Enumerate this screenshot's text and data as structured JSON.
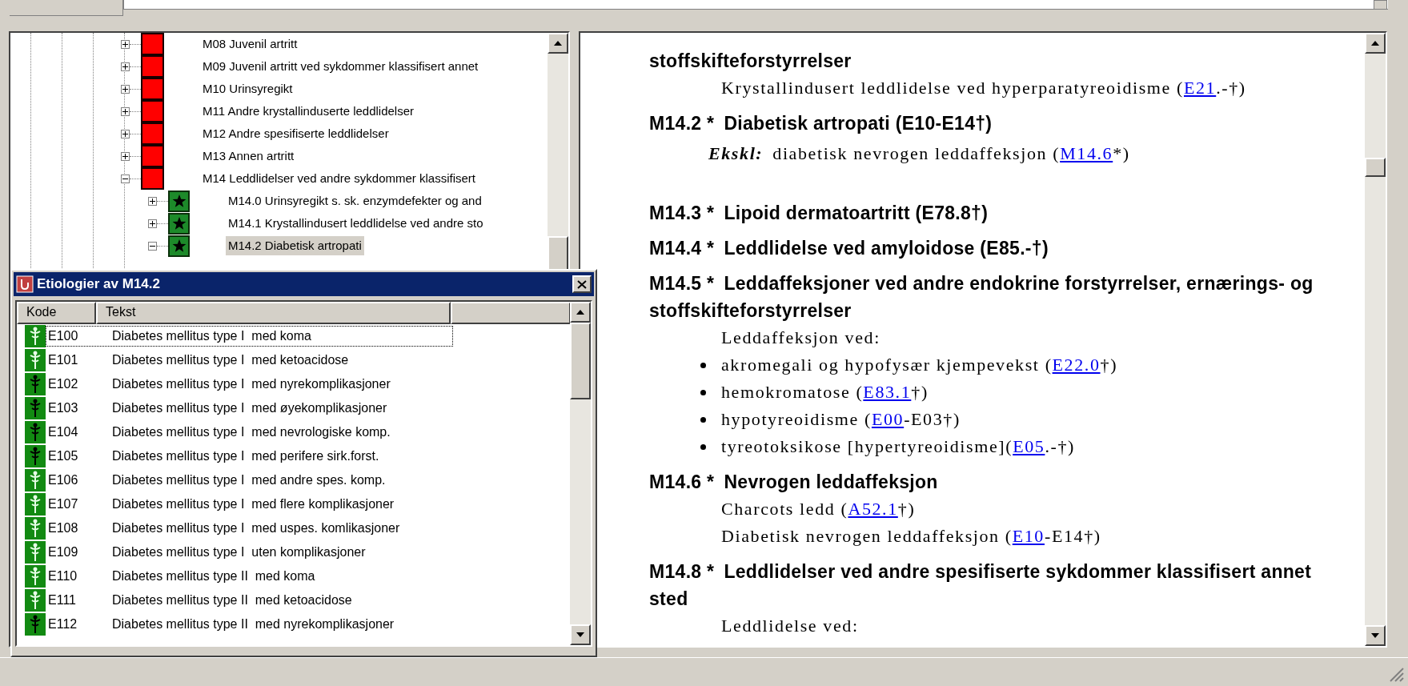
{
  "tree": {
    "items": [
      {
        "label": "M08 Juvenil artritt",
        "kind": "block",
        "expanded": false,
        "selected": false
      },
      {
        "label": "M09 Juvenil artritt ved sykdommer klassifisert annet",
        "kind": "block",
        "expanded": false,
        "selected": false
      },
      {
        "label": "M10 Urinsyregikt",
        "kind": "block",
        "expanded": false,
        "selected": false
      },
      {
        "label": "M11 Andre krystallinduserte leddlidelser",
        "kind": "block",
        "expanded": false,
        "selected": false
      },
      {
        "label": "M12 Andre spesifiserte leddlidelser",
        "kind": "block",
        "expanded": false,
        "selected": false
      },
      {
        "label": "M13 Annen artritt",
        "kind": "block",
        "expanded": false,
        "selected": false
      },
      {
        "label": "M14 Leddlidelser ved andre sykdommer klassifisert",
        "kind": "block",
        "expanded": true,
        "selected": false,
        "children": [
          {
            "label": "M14.0 Urinsyregikt s. sk. enzymdefekter og and",
            "kind": "star",
            "expanded": false,
            "selected": false
          },
          {
            "label": "M14.1 Krystallindusert leddlidelse ved andre sto",
            "kind": "star",
            "expanded": false,
            "selected": false
          },
          {
            "label": "M14.2 Diabetisk artropati",
            "kind": "star",
            "expanded": true,
            "selected": true
          }
        ]
      }
    ]
  },
  "dialog": {
    "title": "Etiologier av M14.2",
    "columns": [
      "Kode",
      "Tekst"
    ],
    "rows": [
      {
        "code": "E100",
        "text": "Diabetes mellitus type I  med koma",
        "kind": "light",
        "selected": true
      },
      {
        "code": "E101",
        "text": "Diabetes mellitus type I  med ketoacidose",
        "kind": "light",
        "selected": false
      },
      {
        "code": "E102",
        "text": "Diabetes mellitus type I  med nyrekomplikasjoner",
        "kind": "dark",
        "selected": false
      },
      {
        "code": "E103",
        "text": "Diabetes mellitus type I  med øyekomplikasjoner",
        "kind": "dark",
        "selected": false
      },
      {
        "code": "E104",
        "text": "Diabetes mellitus type I  med nevrologiske komp.",
        "kind": "dark",
        "selected": false
      },
      {
        "code": "E105",
        "text": "Diabetes mellitus type I  med perifere sirk.forst.",
        "kind": "dark",
        "selected": false
      },
      {
        "code": "E106",
        "text": "Diabetes mellitus type I  med andre spes. komp.",
        "kind": "light",
        "selected": false
      },
      {
        "code": "E107",
        "text": "Diabetes mellitus type I  med flere komplikasjoner",
        "kind": "light",
        "selected": false
      },
      {
        "code": "E108",
        "text": "Diabetes mellitus type I  med uspes. komlikasjoner",
        "kind": "light",
        "selected": false
      },
      {
        "code": "E109",
        "text": "Diabetes mellitus type I  uten komplikasjoner",
        "kind": "light",
        "selected": false
      },
      {
        "code": "E110",
        "text": "Diabetes mellitus type II  med koma",
        "kind": "light",
        "selected": false
      },
      {
        "code": "E111",
        "text": "Diabetes mellitus type II  med ketoacidose",
        "kind": "light",
        "selected": false
      },
      {
        "code": "E112",
        "text": "Diabetes mellitus type II  med nyrekomplikasjoner",
        "kind": "dark",
        "selected": false
      }
    ]
  },
  "content": [
    {
      "kind": "heading",
      "title": "stoffskifteforstyrrelser"
    },
    {
      "kind": "para",
      "parts": [
        {
          "text": "Krystallindusert leddlidelse ved hyperparatyreoidisme ("
        },
        {
          "link": "E21"
        },
        {
          "text": ".-†)"
        }
      ]
    },
    {
      "kind": "heading",
      "code": "M14.2 *",
      "title": "Diabetisk artropati (E10-E14†)"
    },
    {
      "kind": "excl",
      "label": "Ekskl:",
      "parts": [
        {
          "text": "diabetisk nevrogen leddaffeksjon ("
        },
        {
          "link": "M14.6"
        },
        {
          "text": "*)"
        }
      ]
    },
    {
      "kind": "heading",
      "code": "M14.3 *",
      "title": "Lipoid dermatoartritt (E78.8†)"
    },
    {
      "kind": "heading",
      "code": "M14.4 *",
      "title": "Leddlidelse ved amyloidose (E85.-†)"
    },
    {
      "kind": "heading",
      "code": "M14.5 *",
      "title": "Leddaffeksjoner ved andre endokrine forstyrrelser, ernærings- og stoffskifteforstyrrelser"
    },
    {
      "kind": "para",
      "parts": [
        {
          "text": "Leddaffeksjon ved:"
        }
      ]
    },
    {
      "kind": "bullet",
      "parts": [
        {
          "text": "akromegali og hypofysær kjempevekst ("
        },
        {
          "link": "E22.0"
        },
        {
          "text": "†)"
        }
      ]
    },
    {
      "kind": "bullet",
      "parts": [
        {
          "text": "hemokromatose ("
        },
        {
          "link": "E83.1"
        },
        {
          "text": "†)"
        }
      ]
    },
    {
      "kind": "bullet",
      "parts": [
        {
          "text": "hypotyreoidisme ("
        },
        {
          "link": "E00"
        },
        {
          "text": "-E03†)"
        }
      ]
    },
    {
      "kind": "bullet",
      "parts": [
        {
          "text": "tyreotoksikose [hypertyreoidisme]("
        },
        {
          "link": "E05"
        },
        {
          "text": ".-†)"
        }
      ]
    },
    {
      "kind": "heading",
      "code": "M14.6 *",
      "title": "Nevrogen leddaffeksjon"
    },
    {
      "kind": "para",
      "parts": [
        {
          "text": "Charcots ledd ("
        },
        {
          "link": "A52.1"
        },
        {
          "text": "†)"
        }
      ]
    },
    {
      "kind": "para",
      "parts": [
        {
          "text": "Diabetisk nevrogen leddaffeksjon ("
        },
        {
          "link": "E10"
        },
        {
          "text": "-E14†)"
        }
      ]
    },
    {
      "kind": "heading",
      "code": "M14.8 *",
      "title": "Leddlidelser ved andre spesifiserte sykdommer klassifisert annet sted"
    },
    {
      "kind": "para",
      "parts": [
        {
          "text": "Leddlidelse ved:"
        }
      ]
    }
  ]
}
